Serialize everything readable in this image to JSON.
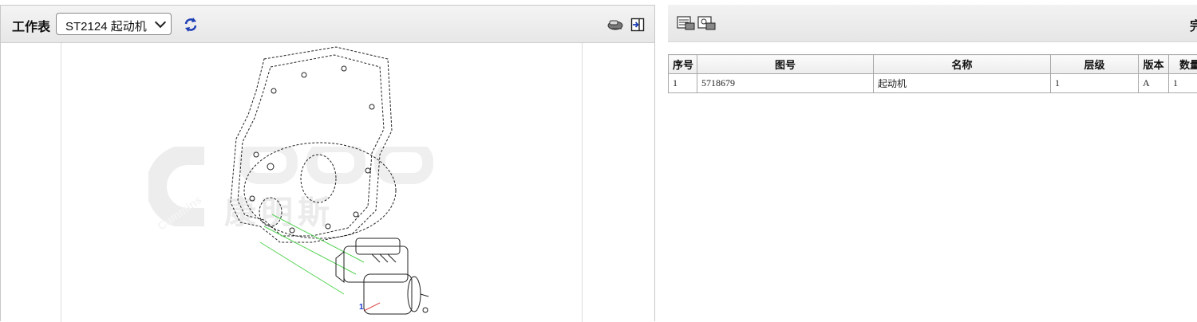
{
  "worksheet": {
    "label": "工作表",
    "selected": "ST2124 起动机"
  },
  "drawing": {
    "watermark": "康明斯",
    "watermark_brand": "Cummins",
    "callout": "1"
  },
  "right_toolbar": {
    "cut_text": "完"
  },
  "bom_table": {
    "headers": [
      "序号",
      "图号",
      "名称",
      "层级",
      "版本",
      "数量"
    ],
    "rows": [
      [
        "1",
        "5718679",
        "起动机",
        "1",
        "A",
        "1"
      ]
    ]
  },
  "icons": [
    "refresh-icon",
    "hand-pointer-icon",
    "export-icon",
    "print-list-icon",
    "print-detail-icon",
    "chevron-down-icon"
  ]
}
